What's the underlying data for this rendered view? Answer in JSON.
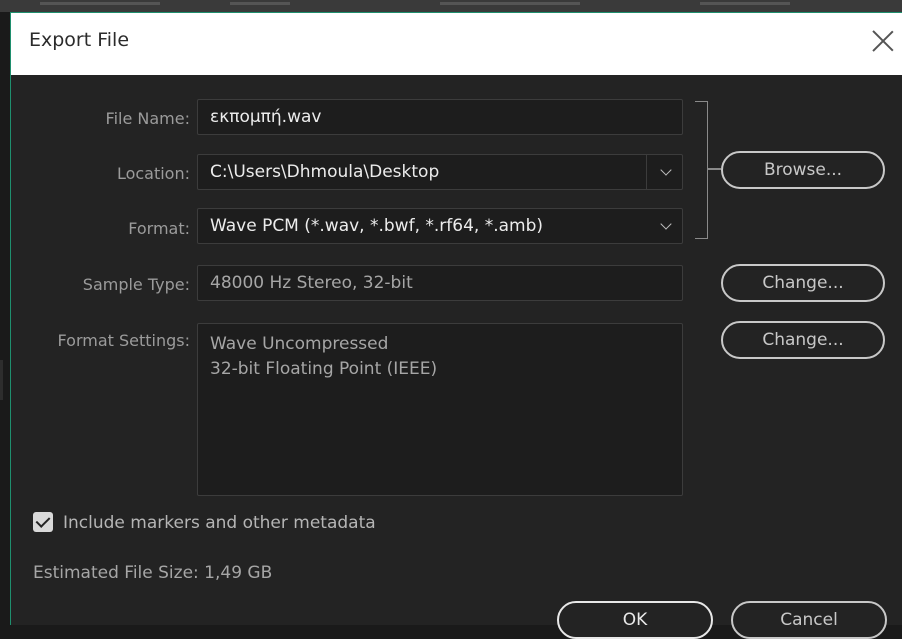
{
  "dialog": {
    "title": "Export File",
    "file_name_label": "File Name:",
    "file_name_value": "εκπομπή.wav",
    "location_label": "Location:",
    "location_value": "C:\\Users\\Dhmoula\\Desktop",
    "format_label": "Format:",
    "format_value": "Wave PCM (*.wav, *.bwf, *.rf64, *.amb)",
    "browse_label": "Browse...",
    "sample_type_label": "Sample Type:",
    "sample_type_value": "48000 Hz Stereo, 32-bit",
    "sample_change_label": "Change...",
    "format_settings_label": "Format Settings:",
    "format_settings_lines": [
      "Wave Uncompressed",
      "32-bit Floating Point (IEEE)"
    ],
    "format_change_label": "Change...",
    "include_markers_label": "Include markers and other metadata",
    "include_markers_checked": true,
    "estimated_size_label": "Estimated File Size: 1,49 GB",
    "ok_label": "OK",
    "cancel_label": "Cancel"
  }
}
